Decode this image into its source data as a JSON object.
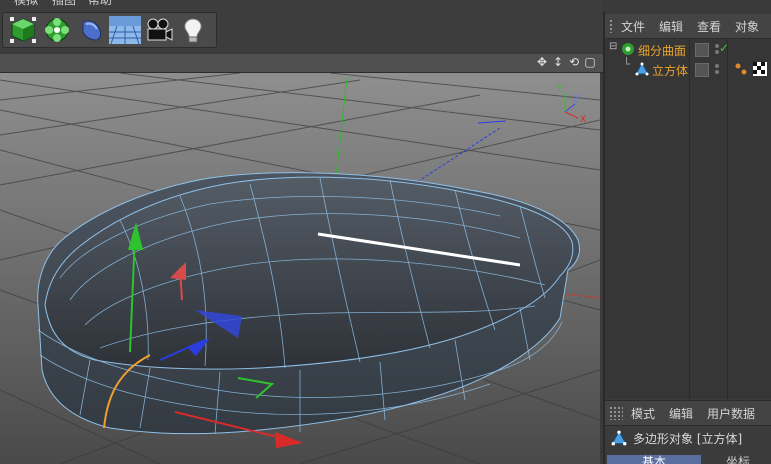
{
  "menu": {
    "items": [
      "模拟",
      "插图",
      "帮助"
    ]
  },
  "toolbar": {
    "tools": [
      {
        "icon": "cube-primitive-icon"
      },
      {
        "icon": "subdivision-surface-icon"
      },
      {
        "icon": "deformer-icon"
      },
      {
        "icon": "floor-scene-icon"
      },
      {
        "icon": "camera-icon"
      },
      {
        "icon": "light-bulb-icon"
      }
    ]
  },
  "viewport": {
    "nav_icons": [
      "move-view-icon",
      "zoom-view-icon",
      "rotate-view-icon",
      "toggle-view-icon"
    ]
  },
  "object_manager": {
    "tabs": [
      "文件",
      "编辑",
      "查看",
      "对象"
    ],
    "objects": [
      {
        "name": "细分曲面",
        "icon": "subdivision-surface-icon",
        "check": "✓"
      },
      {
        "name": "立方体",
        "icon": "polygon-object-icon"
      }
    ]
  },
  "attribute_manager": {
    "tabs": [
      "模式",
      "编辑",
      "用户数据"
    ],
    "title": "多边形对象 [立方体]",
    "subtabs": [
      "基本",
      "坐标"
    ]
  },
  "colors": {
    "accent_orange": "#e8a32c",
    "axis_x": "#d92a2a",
    "axis_y": "#2ec22e",
    "axis_z": "#2a3ee0",
    "mesh_wire": "#8fc0e8"
  }
}
